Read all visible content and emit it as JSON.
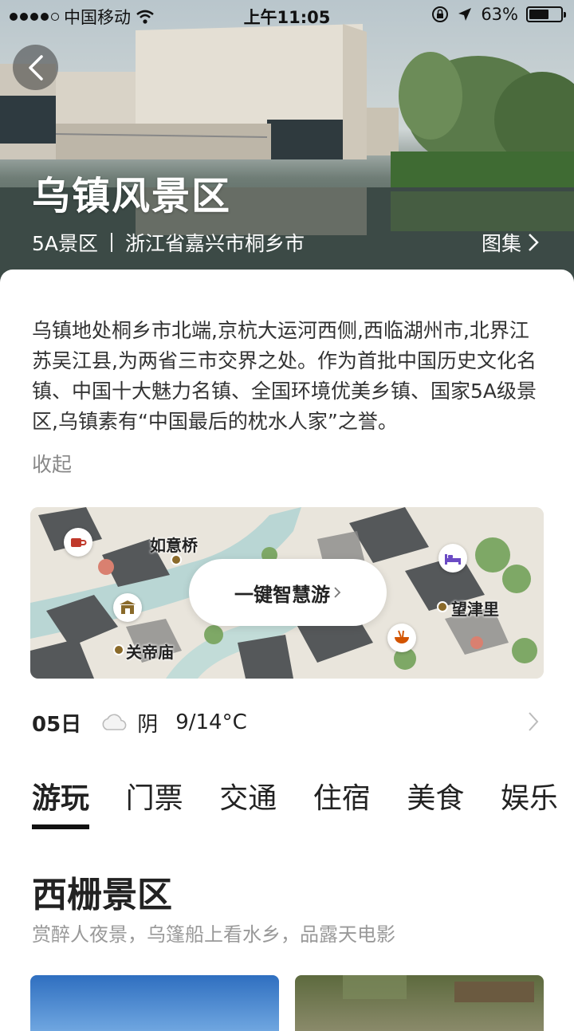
{
  "status_bar": {
    "carrier": "中国移动",
    "time": "上午11:05",
    "battery": "63%",
    "battery_level": 0.63
  },
  "hero": {
    "title": "乌镇风景区",
    "level": "5A景区",
    "location": "浙江省嘉兴市桐乡市",
    "gallery_label": "图集"
  },
  "intro": {
    "text": "乌镇地处桐乡市北端,京杭大运河西侧,西临湖州市,北界江苏吴江县,为两省三市交界之处。作为首批中国历史文化名镇、中国十大魅力名镇、全国环境优美乡镇、国家5A级景区,乌镇素有“中国最后的枕水人家”之誉。",
    "collapse_label": "收起"
  },
  "map": {
    "button_label": "一键智慧游",
    "pois": [
      "如意桥",
      "关帝庙",
      "望津里"
    ],
    "pin_icons": [
      "coffee-icon",
      "gate-icon",
      "bed-icon",
      "noodle-icon"
    ]
  },
  "weather": {
    "day": "05日",
    "condition": "阴",
    "temperature": "9/14°C"
  },
  "tabs": [
    "游玩",
    "门票",
    "交通",
    "住宿",
    "美食",
    "娱乐"
  ],
  "active_tab": "游玩",
  "section": {
    "title": "西栅景区",
    "subtitle": "赏醉人夜景，乌篷船上看水乡，品露天电影"
  },
  "colors": {
    "accent": "#111111",
    "muted": "#888888",
    "pin_purple": "#6b4bc4",
    "pin_red": "#c0392b",
    "pin_brown": "#8a6a2a"
  }
}
